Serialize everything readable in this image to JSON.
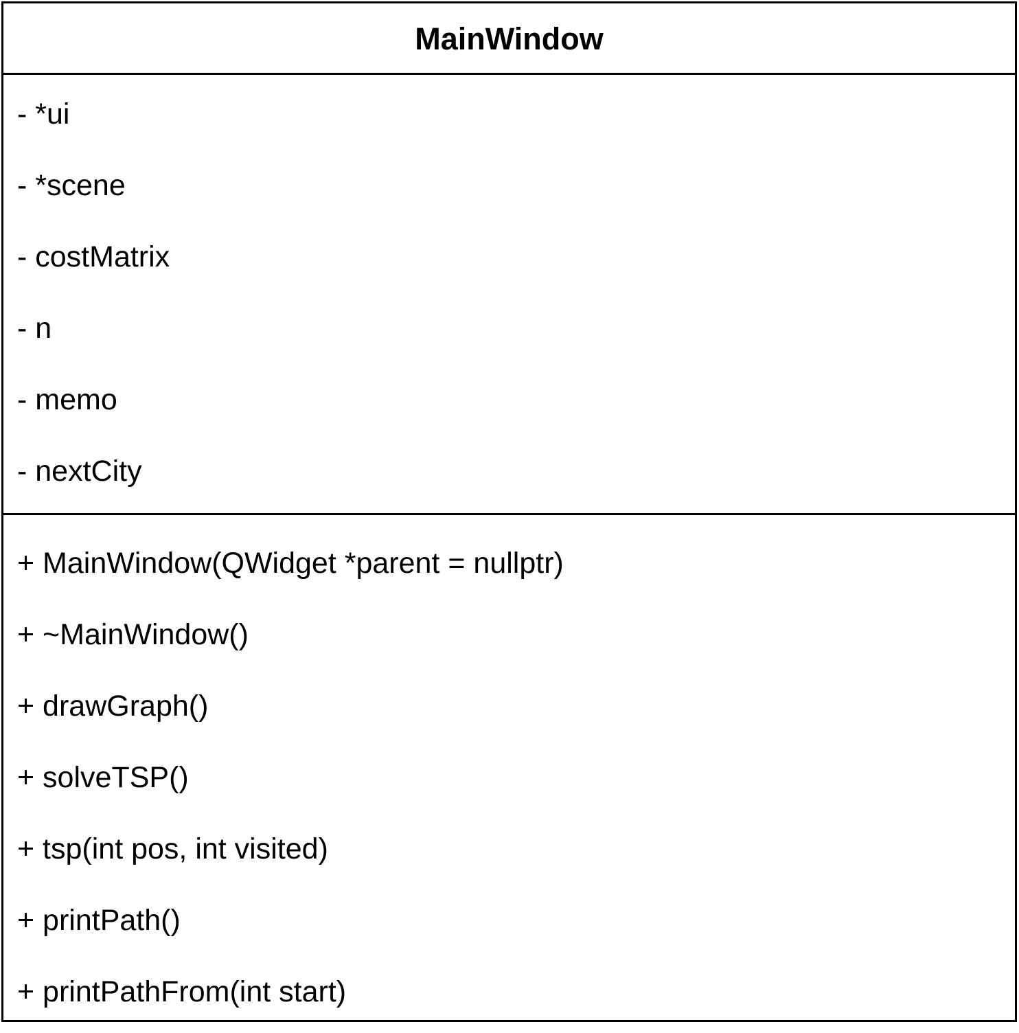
{
  "class": {
    "name": "MainWindow",
    "attributes": [
      "- *ui",
      "- *scene",
      "- costMatrix",
      "- n",
      "- memo",
      "- nextCity"
    ],
    "methods": [
      "+ MainWindow(QWidget *parent = nullptr)",
      "+ ~MainWindow()",
      "+ drawGraph()",
      "+ solveTSP()",
      "+ tsp(int pos, int visited)",
      "+ printPath()",
      "+ printPathFrom(int start)"
    ]
  }
}
